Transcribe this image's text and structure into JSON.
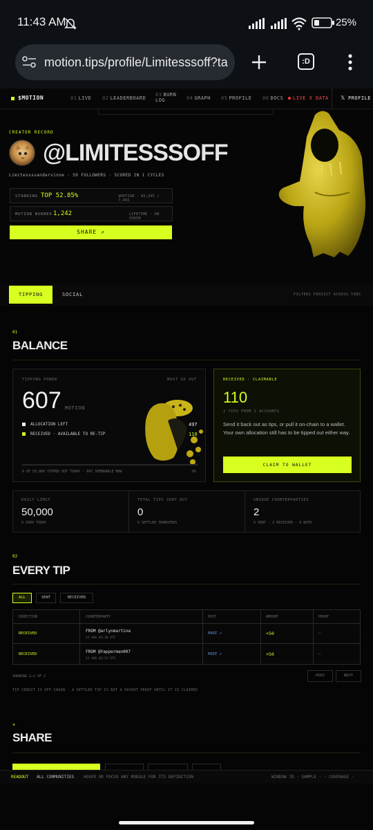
{
  "status": {
    "time": "11:43 AM",
    "battery": "25%"
  },
  "browser": {
    "url": "motion.tips/profile/Limitesssoff?ta",
    "tab_count": ":D"
  },
  "nav": {
    "brand": "$MOTION",
    "items": [
      {
        "num": "01",
        "label": "LIVE"
      },
      {
        "num": "02",
        "label": "LEADERBOARD"
      },
      {
        "num": "03",
        "label": "BURN LOG"
      },
      {
        "num": "04",
        "label": "GRAPH"
      },
      {
        "num": "05",
        "label": "PROFILE"
      },
      {
        "num": "06",
        "label": "DOCS"
      }
    ],
    "live_label": "LIVE X DATA",
    "profile_button": "PROFILE",
    "x_glyph": "𝕏"
  },
  "hero": {
    "eyebrow": "CREATOR RECORD",
    "handle": "@LIMITESSSOFF",
    "subline": "Limitesssvandervinne · 50 FOLLOWERS · SCORED IN 1 CYCLES",
    "standing_label": "STANDING",
    "standing_value": "TOP 52.85%",
    "standing_meta": "$MOTION · #3,945 / 7,465",
    "burned_label": "MOTION BURNED",
    "burned_value": "1,242",
    "burned_meta": "LIFETIME · ON-CHAIN",
    "share_label": "SHARE ↗"
  },
  "tabs": {
    "items": [
      "TIPPING",
      "SOCIAL"
    ],
    "active": "TIPPING",
    "note": "FILTERS PERSIST ACROSS TABS"
  },
  "balance": {
    "num": "01",
    "title": "BALANCE",
    "power_label": "TIPPING POWER",
    "must_go_out": "MUST GO OUT",
    "power_value": "607",
    "power_unit": "MOTION",
    "alloc_label": "ALLOCATION LEFT",
    "alloc_value": "497",
    "received_label": "RECEIVED · AVAILABLE TO RE-TIP",
    "received_value": "110",
    "progress_note": "0 OF 50,000 TIPPED OUT TODAY · 607 SPENDABLE NOW",
    "progress_pct": "0%",
    "progress_fraction": 0,
    "claim_label": "RECEIVED · CLAIMABLE",
    "claim_value": "110",
    "claim_sub": "2 TIPS FROM 2 ACCOUNTS",
    "claim_text": "Send it back out as tips, or pull it on-chain to a wallet. Your own allocation still has to be tipped out either way.",
    "claim_button": "CLAIM TO WALLET",
    "stats": [
      {
        "label": "DAILY LIMIT",
        "value": "50,000",
        "sub": "0 USED TODAY"
      },
      {
        "label": "TOTAL TIPS SENT OUT",
        "value": "0",
        "sub": "0 SETTLED TRANSFERS"
      },
      {
        "label": "UNIQUE COUNTERPARTIES",
        "value": "2",
        "sub": "0 SENT · 2 RECEIVED · 0 BOTH"
      }
    ]
  },
  "tips": {
    "num": "02",
    "title": "EVERY TIP",
    "filters": [
      "ALL",
      "SENT",
      "RECEIVED"
    ],
    "active_filter": "ALL",
    "columns": [
      "DIRECTION",
      "COUNTERPARTY",
      "POST",
      "AMOUNT",
      "PROOF"
    ],
    "rows": [
      {
        "direction": "RECEIVED",
        "from": "FROM @arlynmartina",
        "time": "12 AUG 03:38 UTC",
        "post": "POST ↗",
        "amount": "+50",
        "proof": "—"
      },
      {
        "direction": "RECEIVED",
        "from": "FROM @Yapperman007",
        "time": "12 AUG 03:51 UTC",
        "post": "POST ↗",
        "amount": "+50",
        "proof": "—"
      }
    ],
    "showing": "SHOWING 1–2 OF 2",
    "prev": "PREV",
    "next": "NEXT",
    "footnote": "TIP CREDIT IS OFF-CHAIN · A SETTLED TIP IS NOT A PAYOUT PROOF UNTIL IT IS CLAIMED"
  },
  "share": {
    "num": "+",
    "title": "SHARE"
  },
  "readout": {
    "label": "READOUT",
    "text1": "ALL COMMUNITIES",
    "text2": "HOVER OR FOCUS ANY MODULE FOR ITS DEFINITION",
    "right": "WINDOW 7D · SAMPLE · · COVERAGE ·"
  }
}
